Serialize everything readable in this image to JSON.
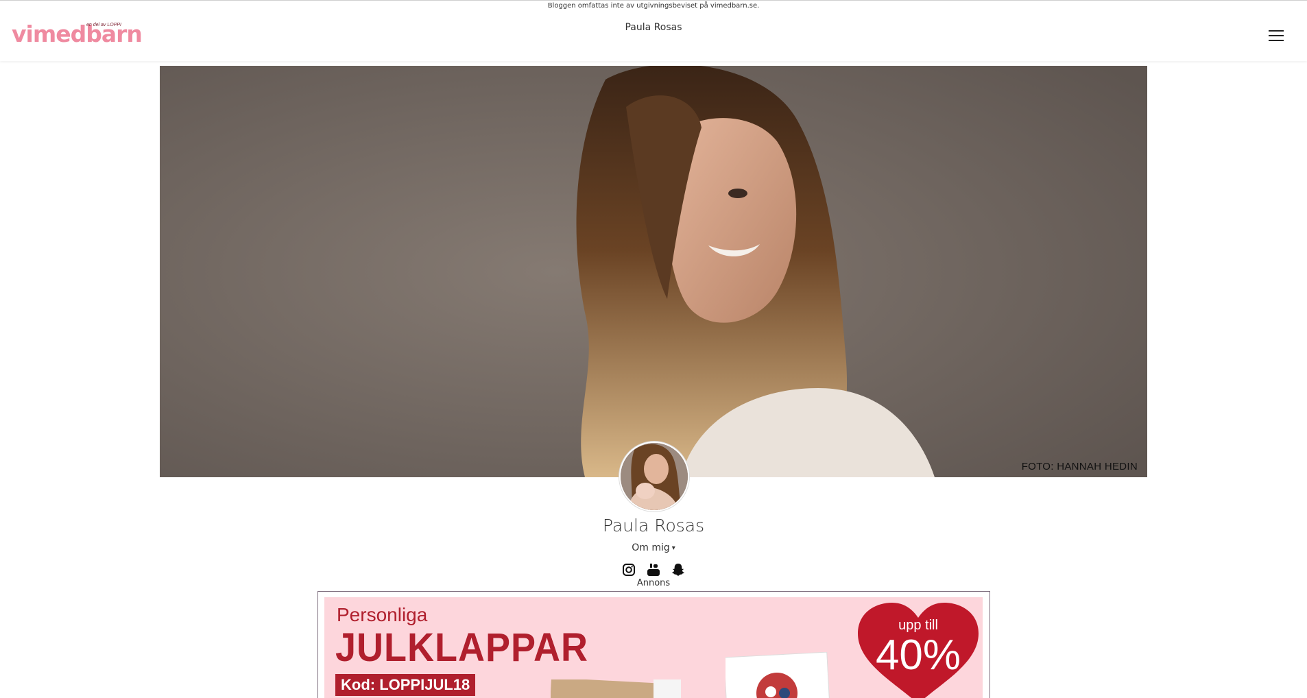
{
  "header": {
    "disclaimer": "Bloggen omfattas inte av utgivningsbeviset på vimedbarn.se.",
    "logo_text": "vimedbarn",
    "logo_tagline": "en del av LOPPI",
    "title": "Paula Rosas",
    "menu_icon": "hamburger-menu-icon"
  },
  "hero": {
    "photo_credit": "FOTO: HANNAH HEDIN"
  },
  "profile": {
    "name": "Paula Rosas",
    "about_label": "Om mig",
    "socials": [
      {
        "icon": "instagram-icon"
      },
      {
        "icon": "youtube-icon"
      },
      {
        "icon": "snapchat-icon"
      }
    ]
  },
  "ad": {
    "label": "Annons",
    "headline_small": "Personliga",
    "headline_big": "JULKLAPPAR",
    "code": "Kod: LOPPIJUL18",
    "badge_small": "upp till",
    "badge_big": "40%",
    "colors": {
      "background": "#fdd6dc",
      "accent": "#b01f2d"
    }
  }
}
